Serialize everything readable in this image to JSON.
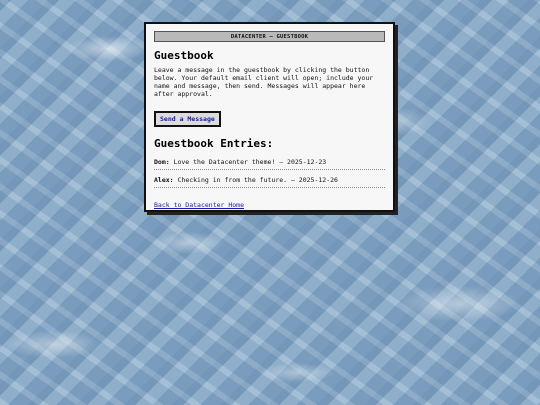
{
  "window": {
    "title": "DATACENTER — GUESTBOOK"
  },
  "main": {
    "heading": "Guestbook",
    "intro": "Leave a message in the guestbook by clicking the button below. Your default email client will open; include your name and message, then send. Messages will appear here after approval.",
    "send_button_label": "Send a Message",
    "entries_heading": "Guestbook Entries:",
    "entries": [
      {
        "name": "Dom:",
        "text": " Love the Datacenter theme! — 2025-12-23"
      },
      {
        "name": "Alex:",
        "text": " Checking in from the future. — 2025-12-26"
      }
    ],
    "home_link_label": "Back to Datacenter Home"
  },
  "colors": {
    "link": "#1a1aa6",
    "panel": "#f7f7f7",
    "titlebar": "#b9b9b9"
  }
}
